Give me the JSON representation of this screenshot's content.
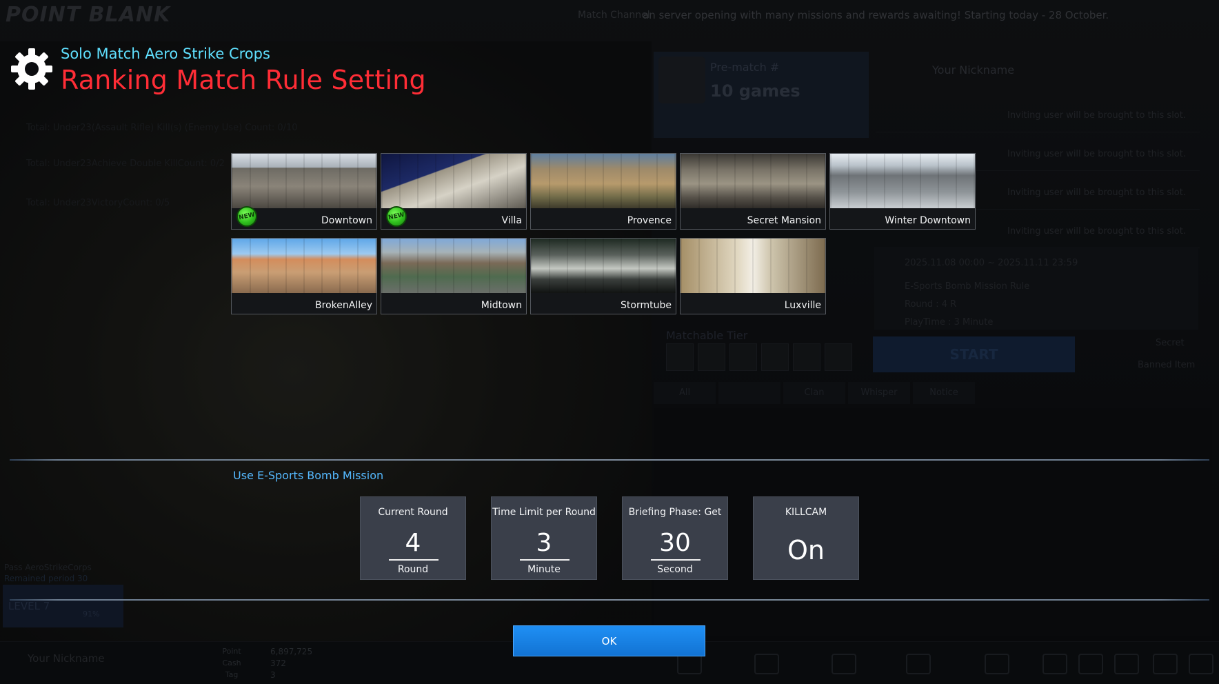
{
  "background": {
    "logo": "POINT BLANK",
    "ticker_label": "Match Channel",
    "ticker_text": "an server opening with many missions and rewards awaiting! Starting today - 28 October.",
    "prematch_label": "Pre-match #",
    "prematch_value": "10 games",
    "nickname": "Your Nickname",
    "invite_text": "Inviting user will be brought to this slot.",
    "info_date": "2025.11.08 00:00 ~ 2025.11.11 23:59",
    "info_rule": "E-Sports Bomb Mission Rule",
    "info_round": "Round : 4 R",
    "info_playtime": "PlayTime : 3 Minute",
    "start_label": "START",
    "secret_label": "Secret",
    "banned_label": "Banned Item",
    "tier_label": "Matchable Tier",
    "tabs": [
      "All",
      "",
      "Clan",
      "Whisper",
      "Notice"
    ],
    "missions": [
      "Total: Under23(Assault Rifle) Kill(s) (Enemy Use) Count: 0/10",
      "Total: Under23Achieve Double KillCount: 0/2",
      "Total: Under23VictoryCount: 0/5"
    ],
    "pass_label": "Pass AeroStrikeCorps",
    "pass_sub": "Remained period 30",
    "level_label": "LEVEL 7",
    "level_pct": "91%",
    "currency": [
      {
        "label": "Point",
        "value": "6,897,725"
      },
      {
        "label": "Cash",
        "value": "372"
      },
      {
        "label": "Tag",
        "value": "3"
      }
    ]
  },
  "header": {
    "subtitle": "Solo Match Aero Strike Crops",
    "title": "Ranking Match Rule Setting",
    "icon": "gear-icon"
  },
  "maps": [
    {
      "name": "Downtown",
      "new": true
    },
    {
      "name": "Villa",
      "new": true
    },
    {
      "name": "Provence",
      "new": false
    },
    {
      "name": "Secret Mansion",
      "new": false
    },
    {
      "name": "Winter Downtown",
      "new": false
    },
    {
      "name": "BrokenAlley",
      "new": false
    },
    {
      "name": "Midtown",
      "new": false
    },
    {
      "name": "Stormtube",
      "new": false
    },
    {
      "name": "Luxville",
      "new": false
    }
  ],
  "new_badge": "NEW",
  "esports_label": "Use E-Sports Bomb Mission",
  "settings": [
    {
      "title": "Current Round",
      "value": "4",
      "unit": "Round"
    },
    {
      "title": "Time Limit per Round",
      "value": "3",
      "unit": "Minute"
    },
    {
      "title": "Briefing Phase: Get",
      "value": "30",
      "unit": "Second"
    },
    {
      "title": "KILLCAM",
      "value": "On",
      "unit": ""
    }
  ],
  "ok_label": "OK",
  "colors": {
    "title_red": "#ff2d36",
    "subtitle_cyan": "#5fe0ff",
    "link_blue": "#55b9ff",
    "ok_blue": "#1f8ff4",
    "new_green": "#2fbf1d"
  }
}
